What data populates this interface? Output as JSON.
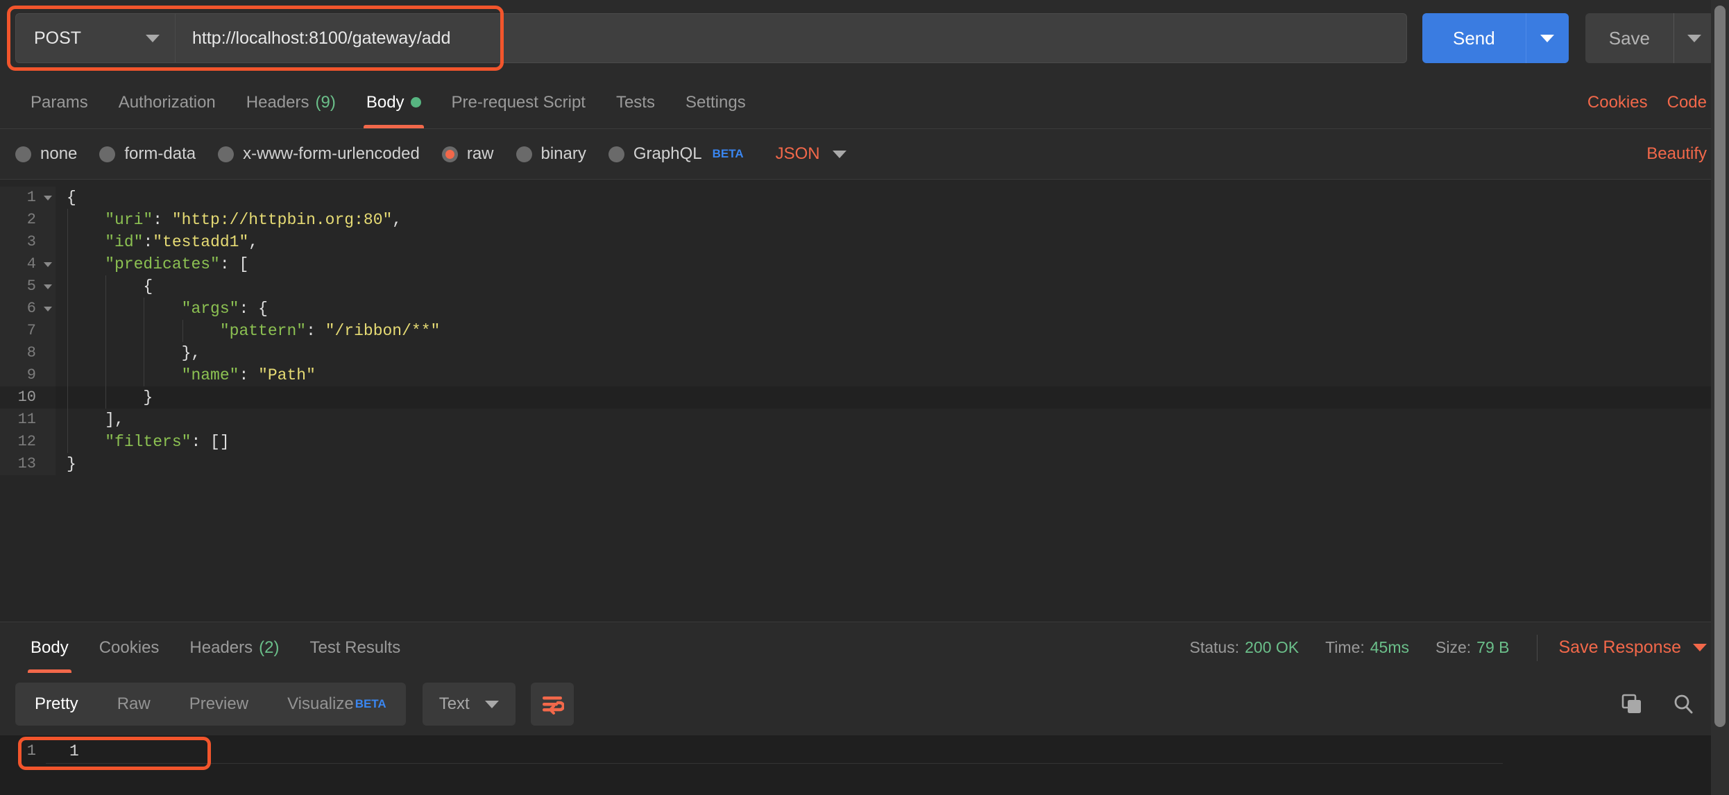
{
  "request": {
    "method": "POST",
    "url": "http://localhost:8100/gateway/add",
    "url_placeholder": "Enter request URL",
    "send_label": "Send",
    "save_label": "Save",
    "highlight_color": "#f2552c",
    "accent_color": "#f2684a",
    "send_color": "#3a7ce1"
  },
  "request_tabs": [
    {
      "label": "Params",
      "count": "",
      "active": false,
      "dot": false
    },
    {
      "label": "Authorization",
      "count": "",
      "active": false,
      "dot": false
    },
    {
      "label": "Headers",
      "count": "(9)",
      "active": false,
      "dot": false
    },
    {
      "label": "Body",
      "count": "",
      "active": true,
      "dot": true
    },
    {
      "label": "Pre-request Script",
      "count": "",
      "active": false,
      "dot": false
    },
    {
      "label": "Tests",
      "count": "",
      "active": false,
      "dot": false
    },
    {
      "label": "Settings",
      "count": "",
      "active": false,
      "dot": false
    }
  ],
  "tabs_right": {
    "cookies": "Cookies",
    "code": "Code"
  },
  "body_types": [
    {
      "label": "none",
      "checked": false,
      "beta": ""
    },
    {
      "label": "form-data",
      "checked": false,
      "beta": ""
    },
    {
      "label": "x-www-form-urlencoded",
      "checked": false,
      "beta": ""
    },
    {
      "label": "raw",
      "checked": true,
      "beta": ""
    },
    {
      "label": "binary",
      "checked": false,
      "beta": ""
    },
    {
      "label": "GraphQL",
      "checked": false,
      "beta": "BETA"
    }
  ],
  "body_format": {
    "selected": "JSON",
    "beautify": "Beautify"
  },
  "editor": {
    "lines": [
      {
        "n": "1",
        "fold": true,
        "text": "{",
        "highlight": false
      },
      {
        "n": "2",
        "fold": false,
        "text": "    \"uri\": \"http://httpbin.org:80\",",
        "highlight": false
      },
      {
        "n": "3",
        "fold": false,
        "text": "    \"id\":\"testadd1\",",
        "highlight": false
      },
      {
        "n": "4",
        "fold": true,
        "text": "    \"predicates\": [",
        "highlight": false
      },
      {
        "n": "5",
        "fold": true,
        "text": "        {",
        "highlight": false
      },
      {
        "n": "6",
        "fold": true,
        "text": "            \"args\": {",
        "highlight": false
      },
      {
        "n": "7",
        "fold": false,
        "text": "                \"pattern\": \"/ribbon/**\"",
        "highlight": false
      },
      {
        "n": "8",
        "fold": false,
        "text": "            },",
        "highlight": false
      },
      {
        "n": "9",
        "fold": false,
        "text": "            \"name\": \"Path\"",
        "highlight": false
      },
      {
        "n": "10",
        "fold": false,
        "text": "        }",
        "highlight": true
      },
      {
        "n": "11",
        "fold": false,
        "text": "    ],",
        "highlight": false
      },
      {
        "n": "12",
        "fold": false,
        "text": "    \"filters\": []",
        "highlight": false
      },
      {
        "n": "13",
        "fold": false,
        "text": "}",
        "highlight": false
      }
    ]
  },
  "response_tabs": [
    {
      "label": "Body",
      "count": "",
      "active": true
    },
    {
      "label": "Cookies",
      "count": "",
      "active": false
    },
    {
      "label": "Headers",
      "count": "(2)",
      "active": false
    },
    {
      "label": "Test Results",
      "count": "",
      "active": false
    }
  ],
  "response_meta": {
    "status_label": "Status:",
    "status_value": "200 OK",
    "time_label": "Time:",
    "time_value": "45ms",
    "size_label": "Size:",
    "size_value": "79 B",
    "save_response": "Save Response"
  },
  "response_format": {
    "views": [
      {
        "label": "Pretty",
        "active": true,
        "beta": ""
      },
      {
        "label": "Raw",
        "active": false,
        "beta": ""
      },
      {
        "label": "Preview",
        "active": false,
        "beta": ""
      },
      {
        "label": "Visualize",
        "active": false,
        "beta": "BETA"
      }
    ],
    "type_selected": "Text",
    "wrap_icon": "word-wrap-icon",
    "copy_icon": "copy-icon",
    "search_icon": "search-icon"
  },
  "response_body": {
    "line_number": "1",
    "content": "1"
  }
}
